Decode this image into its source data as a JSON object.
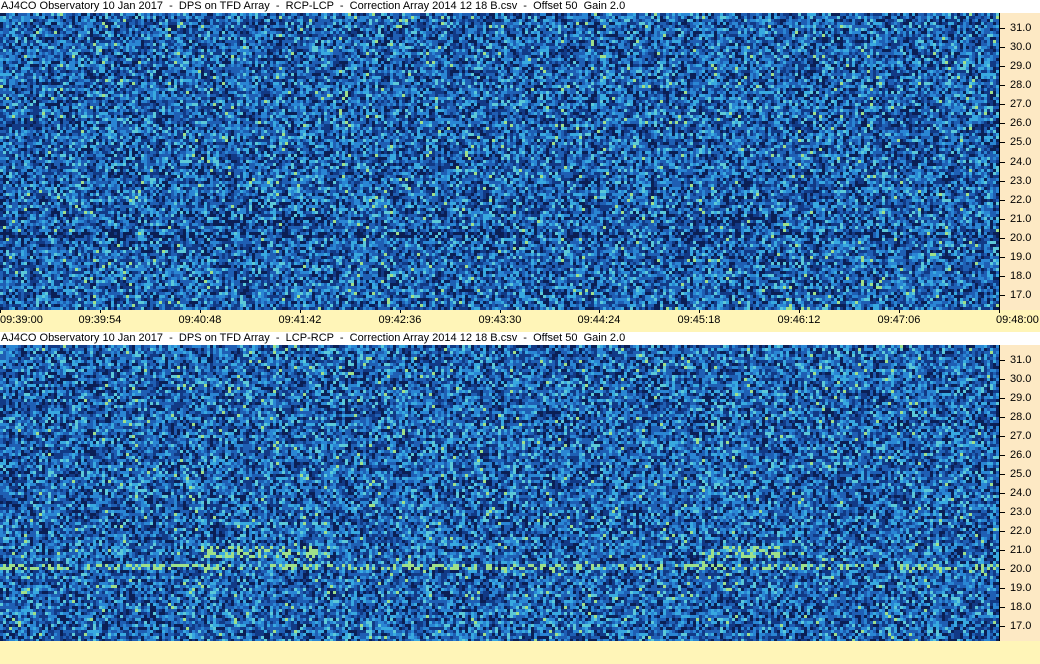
{
  "colors": {
    "background_blue": "#1f63b8",
    "axis_panel": "#fde9c4",
    "time_bar": "#fff5b8"
  },
  "chart_data": [
    {
      "type": "heatmap",
      "title": "AJ4CO Observatory 10 Jan 2017  -  DPS on TFD Array  -  RCP-LCP  -  Correction Array 2014 12 18 B.csv  -  Offset 50  Gain 2.0",
      "yticks": [
        "31.0",
        "30.0",
        "29.0",
        "28.0",
        "27.0",
        "26.0",
        "25.0",
        "24.0",
        "23.0",
        "22.0",
        "21.0",
        "20.0",
        "19.0",
        "18.0",
        "17.0"
      ],
      "ylim": [
        16.2,
        31.8
      ],
      "xticks": [
        "09:39:00",
        "09:39:54",
        "09:40:48",
        "09:41:42",
        "09:42:36",
        "09:43:30",
        "09:44:24",
        "09:45:18",
        "09:46:12",
        "09:47:06",
        "09:48:00"
      ],
      "polarity": "dark"
    },
    {
      "type": "heatmap",
      "title": "AJ4CO Observatory 10 Jan 2017  -  DPS on TFD Array  -  LCP-RCP  -  Correction Array 2014 12 18 B.csv  -  Offset 50  Gain 2.0",
      "yticks": [
        "31.0",
        "30.0",
        "29.0",
        "28.0",
        "27.0",
        "26.0",
        "25.0",
        "24.0",
        "23.0",
        "22.0",
        "21.0",
        "20.0",
        "19.0",
        "18.0",
        "17.0"
      ],
      "ylim": [
        16.2,
        31.8
      ],
      "xticks": [],
      "polarity": "bright"
    }
  ]
}
